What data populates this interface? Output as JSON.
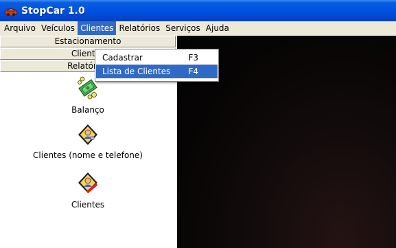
{
  "window": {
    "title": "StopCar 1.0"
  },
  "menubar": {
    "items": [
      {
        "label": "Arquivo"
      },
      {
        "label": "Veículos"
      },
      {
        "label": "Clientes"
      },
      {
        "label": "Relatórios"
      },
      {
        "label": "Serviços"
      },
      {
        "label": "Ajuda"
      }
    ],
    "active_index": 2
  },
  "dropdown": {
    "items": [
      {
        "label": "Cadastrar",
        "shortcut": "F3"
      },
      {
        "label": "Lista de Clientes",
        "shortcut": "F4"
      }
    ],
    "highlighted_index": 1
  },
  "leftpanel": {
    "headers": [
      {
        "label": "Estacionamento"
      },
      {
        "label": "Clientes"
      },
      {
        "label": "Relatórios"
      }
    ],
    "reports": [
      {
        "label": "Balanço",
        "icon": "money-icon"
      },
      {
        "label": "Clientes (nome e telefone)",
        "icon": "client-contacts-icon"
      },
      {
        "label": "Clientes",
        "icon": "client-cancel-icon"
      }
    ]
  },
  "colors": {
    "titlebar": "#0054e3",
    "menu_highlight": "#316ac5",
    "background": "#ece9d8",
    "dark_area": "#060404"
  }
}
